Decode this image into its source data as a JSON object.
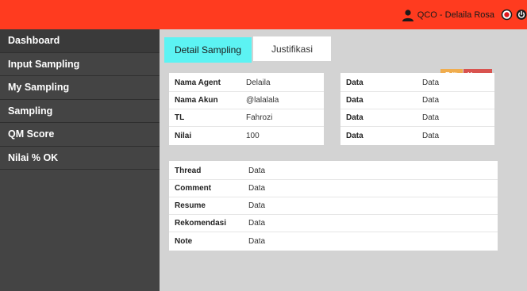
{
  "header": {
    "user_name": "QCO - Delaila Rosa",
    "colors": {
      "bar": "#ff3b1f"
    },
    "icons": [
      "user-icon",
      "record-icon",
      "power-icon"
    ]
  },
  "sidebar": {
    "items": [
      {
        "label": "Dashboard"
      },
      {
        "label": "Input Sampling"
      },
      {
        "label": "My Sampling"
      },
      {
        "label": "Sampling"
      },
      {
        "label": "QM Score"
      },
      {
        "label": "Nilai % OK"
      }
    ]
  },
  "tabs": [
    {
      "label": "Detail Sampling",
      "active": true
    },
    {
      "label": "Justifikasi",
      "active": false
    }
  ],
  "actions": {
    "edit_label": "Edit",
    "hapus_label": "Hapus"
  },
  "detail_left": [
    {
      "label": "Nama Agent",
      "value": "Delaila"
    },
    {
      "label": "Nama Akun",
      "value": "@lalalala"
    },
    {
      "label": "TL",
      "value": "Fahrozi"
    },
    {
      "label": "Nilai",
      "value": "100"
    }
  ],
  "detail_right": [
    {
      "label": "Data",
      "value": "Data"
    },
    {
      "label": "Data",
      "value": "Data"
    },
    {
      "label": "Data",
      "value": "Data"
    },
    {
      "label": "Data",
      "value": "Data"
    }
  ],
  "detail_bottom": [
    {
      "label": "Thread",
      "value": "Data"
    },
    {
      "label": "Comment",
      "value": "Data"
    },
    {
      "label": "Resume",
      "value": "Data"
    },
    {
      "label": "Rekomendasi",
      "value": "Data"
    },
    {
      "label": "Note",
      "value": "Data"
    }
  ]
}
